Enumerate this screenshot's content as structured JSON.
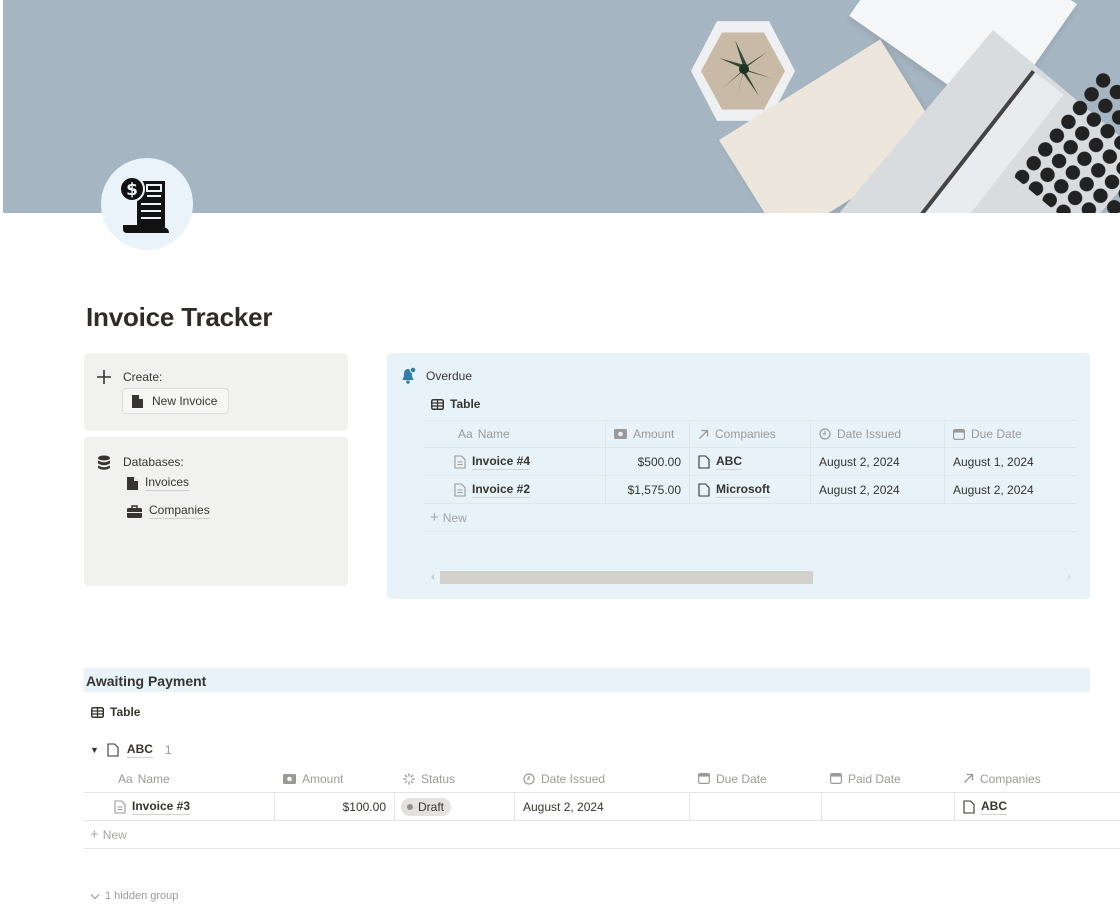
{
  "page": {
    "title": "Invoice Tracker",
    "icon": "invoice-receipt-icon"
  },
  "create_callout": {
    "label": "Create:",
    "icon": "plus-icon",
    "button": {
      "label": "New Invoice",
      "icon": "page-icon"
    }
  },
  "databases_callout": {
    "label": "Databases:",
    "icon": "database-icon",
    "links": [
      {
        "label": "Invoices",
        "icon": "page-icon"
      },
      {
        "label": "Companies",
        "icon": "briefcase-icon"
      }
    ]
  },
  "overdue": {
    "title": "Overdue",
    "icon": "bell-icon",
    "view_label": "Table",
    "columns": [
      {
        "label": "Name",
        "icon": "Aa"
      },
      {
        "label": "Amount",
        "icon": "money-icon"
      },
      {
        "label": "Companies",
        "icon": "relation-arrow-icon"
      },
      {
        "label": "Date Issued",
        "icon": "clock-icon"
      },
      {
        "label": "Due Date",
        "icon": "calendar-icon"
      }
    ],
    "rows": [
      {
        "name": "Invoice #4",
        "amount": "$500.00",
        "company": "ABC",
        "date_issued": "August 2, 2024",
        "due_date": "August 1, 2024"
      },
      {
        "name": "Invoice #2",
        "amount": "$1,575.00",
        "company": "Microsoft",
        "date_issued": "August 2, 2024",
        "due_date": "August 2, 2024"
      }
    ],
    "new_label": "New"
  },
  "awaiting": {
    "title": "Awaiting Payment",
    "view_label": "Table",
    "group": {
      "name": "ABC",
      "count": "1"
    },
    "columns": [
      {
        "label": "Name",
        "icon": "Aa"
      },
      {
        "label": "Amount",
        "icon": "money-icon"
      },
      {
        "label": "Status",
        "icon": "status-spinner-icon"
      },
      {
        "label": "Date Issued",
        "icon": "clock-icon"
      },
      {
        "label": "Due Date",
        "icon": "calendar-icon"
      },
      {
        "label": "Paid Date",
        "icon": "calendar-icon"
      },
      {
        "label": "Companies",
        "icon": "relation-arrow-icon"
      }
    ],
    "rows": [
      {
        "name": "Invoice #3",
        "amount": "$100.00",
        "status": "Draft",
        "date_issued": "August 2, 2024",
        "due_date": "",
        "paid_date": "",
        "company": "ABC"
      }
    ],
    "new_label": "New",
    "hidden_groups": "1 hidden group"
  },
  "colors": {
    "callout_gray": "#f1f1ef",
    "callout_blue": "#e7f3f8",
    "bell_blue": "#337ea9",
    "text": "#37352f",
    "muted": "#9b9a97"
  }
}
